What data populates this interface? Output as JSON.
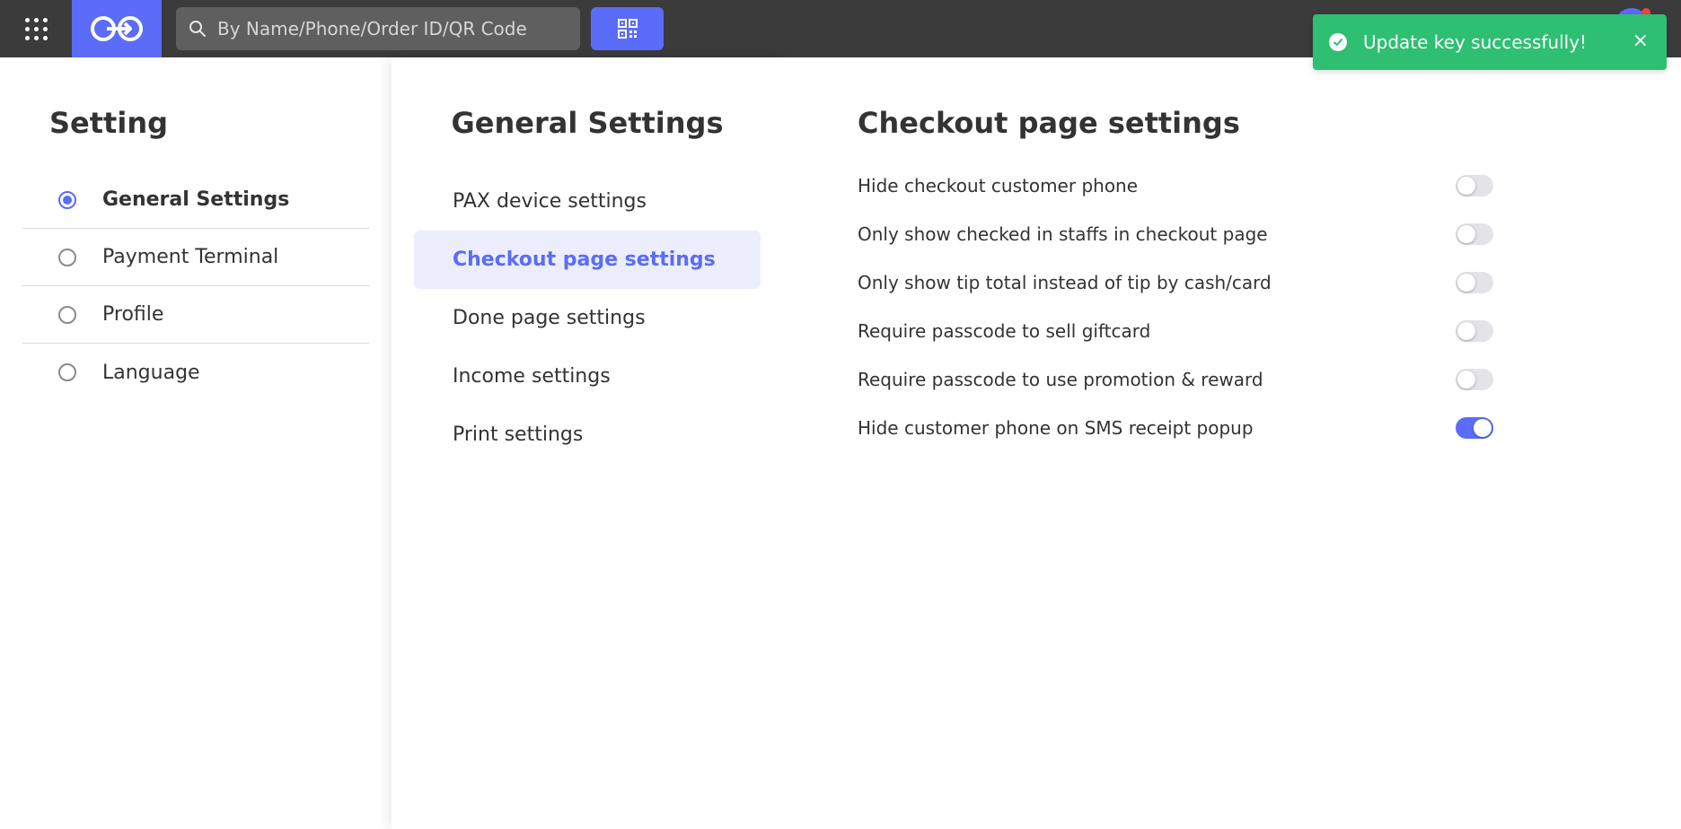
{
  "topbar": {
    "search_placeholder": "By Name/Phone/Order ID/QR Code",
    "accent_color": "#5b6cf8",
    "icons": [
      "apps-grid-icon",
      "brand-logo",
      "search-icon",
      "qr-code-icon",
      "avatar"
    ]
  },
  "toast": {
    "message": "Update key successfully!",
    "close_label": "×",
    "color": "#2ebf72"
  },
  "left": {
    "title": "Setting",
    "items": [
      {
        "label": "General Settings",
        "selected": true
      },
      {
        "label": "Payment Terminal",
        "selected": false
      },
      {
        "label": "Profile",
        "selected": false
      },
      {
        "label": "Language",
        "selected": false
      }
    ]
  },
  "middle": {
    "title": "General Settings",
    "items": [
      {
        "label": "PAX device settings",
        "active": false
      },
      {
        "label": "Checkout page settings",
        "active": true
      },
      {
        "label": "Done page settings",
        "active": false
      },
      {
        "label": "Income settings",
        "active": false
      },
      {
        "label": "Print settings",
        "active": false
      }
    ]
  },
  "right": {
    "title": "Checkout page settings",
    "settings": [
      {
        "label": "Hide checkout customer phone",
        "enabled": false
      },
      {
        "label": "Only show checked in staffs in checkout page",
        "enabled": false
      },
      {
        "label": "Only show tip total instead of tip by cash/card",
        "enabled": false
      },
      {
        "label": "Require passcode to sell giftcard",
        "enabled": false
      },
      {
        "label": "Require passcode to use promotion & reward",
        "enabled": false
      },
      {
        "label": "Hide customer phone on SMS receipt popup",
        "enabled": true
      }
    ]
  }
}
